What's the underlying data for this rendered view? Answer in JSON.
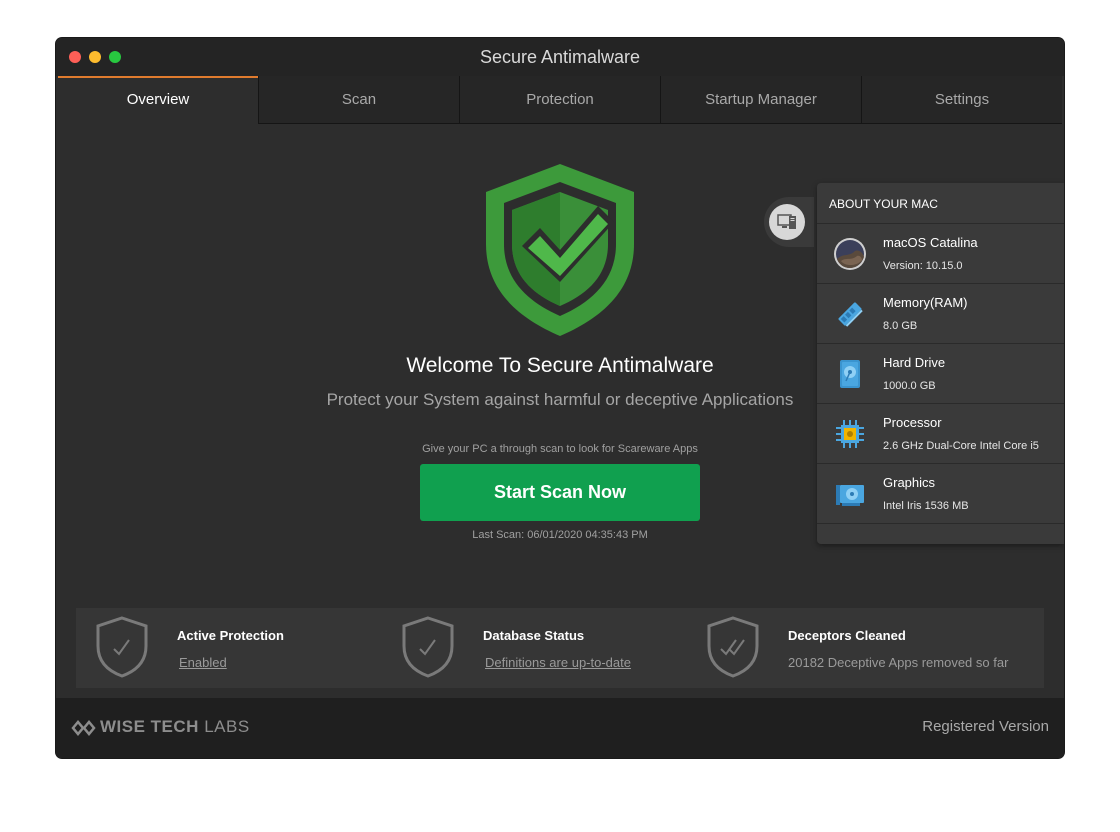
{
  "window": {
    "title": "Secure Antimalware"
  },
  "tabs": [
    {
      "label": "Overview",
      "active": true
    },
    {
      "label": "Scan",
      "active": false
    },
    {
      "label": "Protection",
      "active": false
    },
    {
      "label": "Startup Manager",
      "active": false
    },
    {
      "label": "Settings",
      "active": false
    }
  ],
  "hero": {
    "title": "Welcome To Secure Antimalware",
    "subtitle": "Protect your System against harmful or deceptive Applications",
    "hint": "Give your PC a through scan to look for Scareware Apps",
    "scan_button": "Start Scan Now",
    "last_scan": "Last Scan: 06/01/2020 04:35:43 PM"
  },
  "status": [
    {
      "title": "Active Protection",
      "value": "Enabled",
      "link": true
    },
    {
      "title": "Database Status",
      "value": "Definitions are up-to-date",
      "link": true
    },
    {
      "title": "Deceptors Cleaned",
      "value": "20182 Deceptive Apps removed so far",
      "link": false
    }
  ],
  "about_mac": {
    "header": "ABOUT YOUR MAC",
    "items": [
      {
        "label": "macOS  Catalina",
        "value": "Version: 10.15.0",
        "icon": "macos-catalina-icon"
      },
      {
        "label": "Memory(RAM)",
        "value": "8.0 GB",
        "icon": "memory-icon"
      },
      {
        "label": "Hard Drive",
        "value": "1000.0 GB",
        "icon": "hard-drive-icon"
      },
      {
        "label": "Processor",
        "value": "2.6 GHz Dual-Core Intel Core i5",
        "icon": "processor-icon"
      },
      {
        "label": "Graphics",
        "value": "Intel Iris 1536 MB",
        "icon": "graphics-card-icon"
      }
    ]
  },
  "footer": {
    "brand_bold": "WISE TECH",
    "brand_light": "LABS",
    "registered": "Registered Version"
  },
  "colors": {
    "accent_tab": "#e07b2e",
    "scan_button": "#10a04f",
    "shield_green": "#3d9a3b",
    "window_bg": "#2d2d2d"
  }
}
